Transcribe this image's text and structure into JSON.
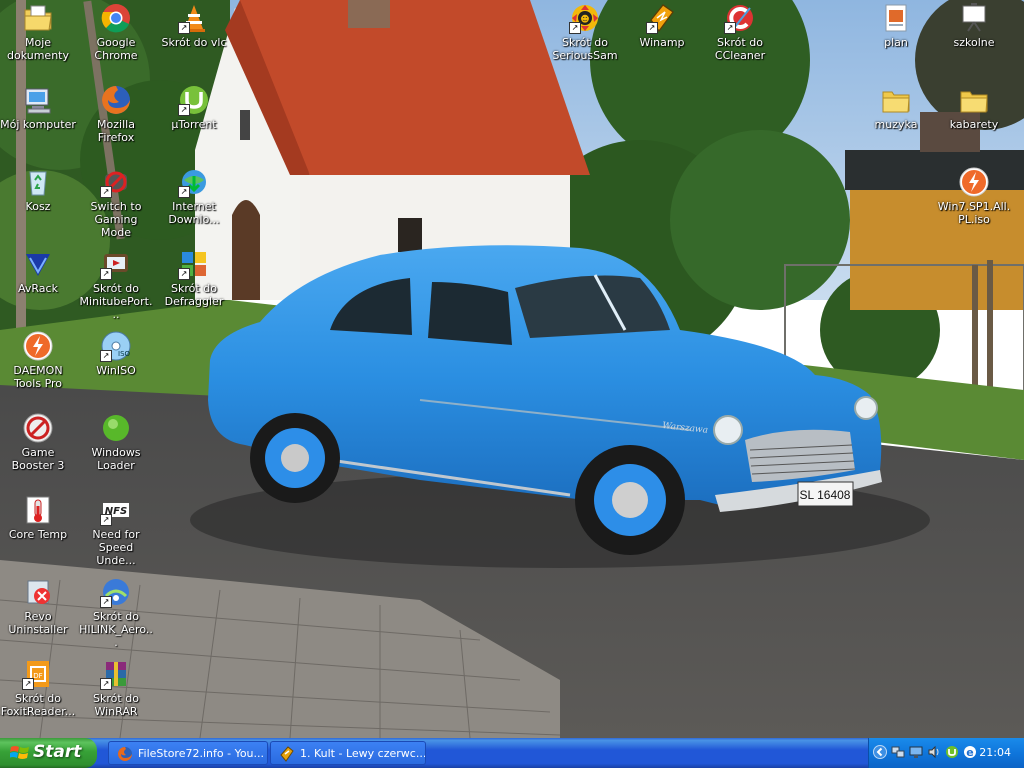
{
  "desktop": {
    "icons": [
      {
        "name": "icon-moje-dokumenty",
        "label": "Moje dokumenty",
        "glyph": "folder-docs-icon",
        "shortcut": false
      },
      {
        "name": "icon-google-chrome",
        "label": "Google Chrome",
        "glyph": "chrome-icon",
        "shortcut": false
      },
      {
        "name": "icon-skrot-do-vlc",
        "label": "Skrót do vlc",
        "glyph": "vlc-cone-icon",
        "shortcut": true
      },
      {
        "name": "icon-moj-komputer",
        "label": "Mój komputer",
        "glyph": "computer-icon",
        "shortcut": false
      },
      {
        "name": "icon-mozilla-firefox",
        "label": "Mozilla Firefox",
        "glyph": "firefox-icon",
        "shortcut": false
      },
      {
        "name": "icon-utorrent",
        "label": "µTorrent",
        "glyph": "utorrent-icon",
        "shortcut": true
      },
      {
        "name": "icon-kosz",
        "label": "Kosz",
        "glyph": "recycle-bin-icon",
        "shortcut": false
      },
      {
        "name": "icon-switch-to-gaming-mode",
        "label": "Switch to Gaming Mode",
        "glyph": "gaming-mode-icon",
        "shortcut": true
      },
      {
        "name": "icon-internet-download",
        "label": "Internet Downlo...",
        "glyph": "internet-download-icon",
        "shortcut": true
      },
      {
        "name": "icon-avrack",
        "label": "AvRack",
        "glyph": "avrack-icon",
        "shortcut": false
      },
      {
        "name": "icon-skrot-do-minitubeport",
        "label": "Skrót do MinitubePort...",
        "glyph": "minitube-icon",
        "shortcut": true
      },
      {
        "name": "icon-skrot-do-defraggler",
        "label": "Skrót do Defraggler",
        "glyph": "defraggler-icon",
        "shortcut": true
      },
      {
        "name": "icon-daemon-tools-pro",
        "label": "DAEMON Tools Pro",
        "glyph": "daemon-tools-icon",
        "shortcut": false
      },
      {
        "name": "icon-winiso",
        "label": "WinISO",
        "glyph": "winiso-disc-icon",
        "shortcut": true
      },
      {
        "name": "icon-game-booster-3",
        "label": "Game Booster 3",
        "glyph": "game-booster-icon",
        "shortcut": false
      },
      {
        "name": "icon-windows-loader",
        "label": "Windows Loader",
        "glyph": "windows-loader-icon",
        "shortcut": false
      },
      {
        "name": "icon-core-temp",
        "label": "Core Temp",
        "glyph": "thermometer-icon",
        "shortcut": false
      },
      {
        "name": "icon-need-for-speed",
        "label": "Need for Speed Unde...",
        "glyph": "nfs-icon",
        "shortcut": true
      },
      {
        "name": "icon-revo-uninstaller",
        "label": "Revo Uninstaller",
        "glyph": "revo-uninstaller-icon",
        "shortcut": false
      },
      {
        "name": "icon-skrot-do-hilink",
        "label": "Skrót do HILINK_Aero...",
        "glyph": "hilink-icon",
        "shortcut": true
      },
      {
        "name": "icon-skrot-do-foxitreader",
        "label": "Skrót do FoxitReader...",
        "glyph": "foxit-pdf-icon",
        "shortcut": true
      },
      {
        "name": "icon-skrot-do-winrar",
        "label": "Skrót do WinRAR",
        "glyph": "winrar-icon",
        "shortcut": true
      },
      {
        "name": "icon-skrot-do-serioussam",
        "label": "Skrót do SeriousSam",
        "glyph": "serious-sam-icon",
        "shortcut": true
      },
      {
        "name": "icon-winamp",
        "label": "Winamp",
        "glyph": "winamp-icon",
        "shortcut": true
      },
      {
        "name": "icon-skrot-do-ccleaner",
        "label": "Skrót do CCleaner",
        "glyph": "ccleaner-icon",
        "shortcut": true
      },
      {
        "name": "icon-plan",
        "label": "plan",
        "glyph": "document-image-icon",
        "shortcut": false
      },
      {
        "name": "icon-szkolne",
        "label": "szkolne",
        "glyph": "presentation-board-icon",
        "shortcut": false
      },
      {
        "name": "icon-muzyka",
        "label": "muzyka",
        "glyph": "folder-icon",
        "shortcut": false
      },
      {
        "name": "icon-kabarety",
        "label": "kabarety",
        "glyph": "folder-icon",
        "shortcut": false
      },
      {
        "name": "icon-win7-sp1-iso",
        "label": "Win7.SP1.All.PL.iso",
        "glyph": "daemon-tools-icon",
        "shortcut": false
      }
    ],
    "wallpaper": {
      "plate_text": "SL 16408",
      "emblem_text": "Warszawa"
    }
  },
  "taskbar": {
    "start_label": "Start",
    "tasks": [
      {
        "label": "FileStore72.info - You...",
        "glyph": "firefox-icon"
      },
      {
        "label": "1. Kult - Lewy czerwc...",
        "glyph": "winamp-icon"
      }
    ],
    "tray": {
      "icons": [
        "chevron-left-icon",
        "network-icon",
        "monitor-icon",
        "volume-icon",
        "utorrent-tray-icon",
        "ie-icon"
      ],
      "clock": "21:04"
    }
  },
  "colors": {
    "taskbar_blue": "#2157d7",
    "start_green": "#37a137",
    "tray_blue": "#0f76dc",
    "car_blue": "#2f90e0"
  }
}
